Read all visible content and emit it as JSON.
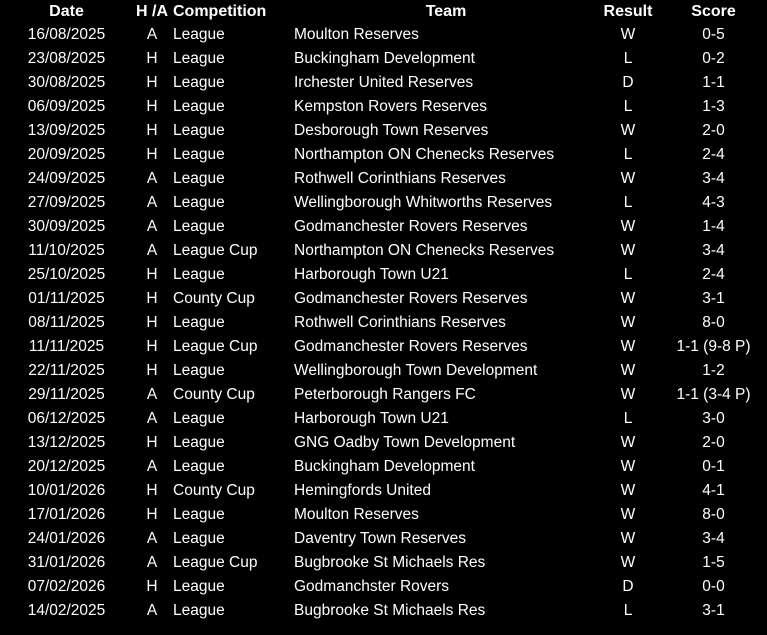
{
  "headers": {
    "date": "Date",
    "ha": "H /A",
    "competition": "Competition",
    "team": "Team",
    "result": "Result",
    "score": "Score"
  },
  "rows": [
    {
      "date": "16/08/2025",
      "ha": "A",
      "competition": "League",
      "team": "Moulton Reserves",
      "result": "W",
      "score": "0-5"
    },
    {
      "date": "23/08/2025",
      "ha": "H",
      "competition": "League",
      "team": "Buckingham Development",
      "result": "L",
      "score": "0-2"
    },
    {
      "date": "30/08/2025",
      "ha": "H",
      "competition": "League",
      "team": "Irchester United Reserves",
      "result": "D",
      "score": "1-1"
    },
    {
      "date": "06/09/2025",
      "ha": "H",
      "competition": "League",
      "team": "Kempston Rovers Reserves",
      "result": "L",
      "score": "1-3"
    },
    {
      "date": "13/09/2025",
      "ha": "H",
      "competition": "League",
      "team": "Desborough Town Reserves",
      "result": "W",
      "score": "2-0"
    },
    {
      "date": "20/09/2025",
      "ha": "H",
      "competition": "League",
      "team": "Northampton ON Chenecks Reserves",
      "result": "L",
      "score": "2-4"
    },
    {
      "date": "24/09/2025",
      "ha": "A",
      "competition": "League",
      "team": "Rothwell Corinthians Reserves",
      "result": "W",
      "score": "3-4"
    },
    {
      "date": "27/09/2025",
      "ha": "A",
      "competition": "League",
      "team": "Wellingborough Whitworths Reserves",
      "result": "L",
      "score": "4-3"
    },
    {
      "date": "30/09/2025",
      "ha": "A",
      "competition": "League",
      "team": "Godmanchester Rovers Reserves",
      "result": "W",
      "score": "1-4"
    },
    {
      "date": "11/10/2025",
      "ha": "A",
      "competition": "League Cup",
      "team": "Northampton ON Chenecks Reserves",
      "result": "W",
      "score": "3-4"
    },
    {
      "date": "25/10/2025",
      "ha": "H",
      "competition": "League",
      "team": "Harborough Town U21",
      "result": "L",
      "score": "2-4"
    },
    {
      "date": "01/11/2025",
      "ha": "H",
      "competition": "County Cup",
      "team": "Godmanchester Rovers Reserves",
      "result": "W",
      "score": "3-1"
    },
    {
      "date": "08/11/2025",
      "ha": "H",
      "competition": "League",
      "team": "Rothwell Corinthians Reserves",
      "result": "W",
      "score": "8-0"
    },
    {
      "date": "11/11/2025",
      "ha": "H",
      "competition": "League Cup",
      "team": "Godmanchester Rovers Reserves",
      "result": "W",
      "score": "1-1 (9-8 P)"
    },
    {
      "date": "22/11/2025",
      "ha": "H",
      "competition": "League",
      "team": "Wellingborough Town Development",
      "result": "W",
      "score": "1-2"
    },
    {
      "date": "29/11/2025",
      "ha": "A",
      "competition": "County Cup",
      "team": "Peterborough Rangers FC",
      "result": "W",
      "score": "1-1 (3-4 P)"
    },
    {
      "date": "06/12/2025",
      "ha": "A",
      "competition": "League",
      "team": "Harborough Town U21",
      "result": "L",
      "score": "3-0"
    },
    {
      "date": "13/12/2025",
      "ha": "H",
      "competition": "League",
      "team": "GNG Oadby Town Development",
      "result": "W",
      "score": "2-0"
    },
    {
      "date": "20/12/2025",
      "ha": "A",
      "competition": "League",
      "team": "Buckingham Development",
      "result": "W",
      "score": "0-1"
    },
    {
      "date": "10/01/2026",
      "ha": "H",
      "competition": "County Cup",
      "team": "Hemingfords United",
      "result": "W",
      "score": "4-1"
    },
    {
      "date": "17/01/2026",
      "ha": "H",
      "competition": "League",
      "team": "Moulton Reserves",
      "result": "W",
      "score": "8-0"
    },
    {
      "date": "24/01/2026",
      "ha": "A",
      "competition": "League",
      "team": "Daventry Town Reserves",
      "result": "W",
      "score": "3-4"
    },
    {
      "date": "31/01/2026",
      "ha": "A",
      "competition": "League Cup",
      "team": "Bugbrooke St Michaels Res",
      "result": "W",
      "score": "1-5"
    },
    {
      "date": "07/02/2026",
      "ha": "H",
      "competition": "League",
      "team": "Godmanchster Rovers",
      "result": "D",
      "score": "0-0"
    },
    {
      "date": "14/02/2025",
      "ha": "A",
      "competition": "League",
      "team": "Bugbrooke St Michaels Res",
      "result": "L",
      "score": "3-1"
    }
  ]
}
